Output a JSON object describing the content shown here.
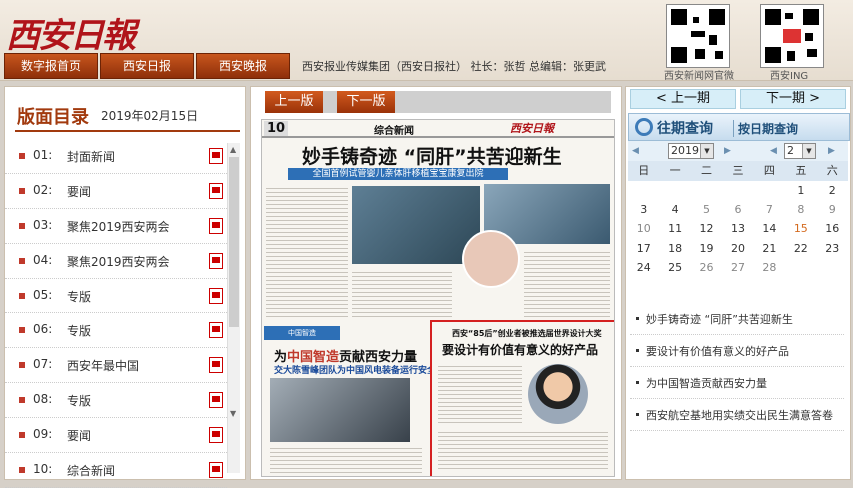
{
  "header": {
    "logo": "西安日報",
    "nav": [
      "数字报首页",
      "西安日报",
      "西安晚报"
    ],
    "info": "西安报业传媒集团（西安日报社）  社长：张哲    总编辑：张更武",
    "qr_labels": [
      "西安新闻网官微",
      "西安ING"
    ]
  },
  "left": {
    "title": "版面目录",
    "date": "2019年02月15日",
    "items": [
      {
        "num": "01:",
        "label": "封面新闻"
      },
      {
        "num": "02:",
        "label": "要闻"
      },
      {
        "num": "03:",
        "label": "聚焦2019西安两会"
      },
      {
        "num": "04:",
        "label": "聚焦2019西安两会"
      },
      {
        "num": "05:",
        "label": "专版"
      },
      {
        "num": "06:",
        "label": "专版"
      },
      {
        "num": "07:",
        "label": "西安年最中国"
      },
      {
        "num": "08:",
        "label": "专版"
      },
      {
        "num": "09:",
        "label": "要闻"
      },
      {
        "num": "10:",
        "label": "综合新闻"
      }
    ]
  },
  "center": {
    "prev_page": "上一版",
    "next_page": "下一版",
    "page": {
      "number": "10",
      "section": "综合新闻",
      "logo": "西安日報",
      "headline": "妙手铸奇迹 “同肝”共苦迎新生",
      "subheadline": "全国首例试管婴儿亲体肝移植宝宝康复出院",
      "mini_nav": "中国智造",
      "headline2_a": "为",
      "headline2_hl": "中国智造",
      "headline2_b": "贡献西安力量",
      "subheadline2": "交大陈雪峰团队为中国风电装备运行安全保驾护航",
      "box_sub": "西安“85后”创业者被推选届世界设计大奖",
      "box_title": "要设计有价值有意义的好产品"
    }
  },
  "right": {
    "prev_issue": "< 上一期",
    "next_issue": "下一期 >",
    "query_title": "往期查询",
    "query_sub": "按日期查询",
    "year": "2019",
    "month": "2",
    "weekdays": [
      "日",
      "一",
      "二",
      "三",
      "四",
      "五",
      "六"
    ],
    "weeks": [
      [
        "",
        "",
        "",
        "",
        "",
        "1",
        "2"
      ],
      [
        "3",
        "4",
        "5",
        "6",
        "7",
        "8",
        "9"
      ],
      [
        "10",
        "11",
        "12",
        "13",
        "14",
        "15",
        "16"
      ],
      [
        "17",
        "18",
        "19",
        "20",
        "21",
        "22",
        "23"
      ],
      [
        "24",
        "25",
        "26",
        "27",
        "28",
        "",
        ""
      ]
    ],
    "news": [
      "妙手铸奇迹 “同肝”共苦迎新生",
      "要设计有价值有意义的好产品",
      "为中国智造贡献西安力量",
      "西安航空基地用实绩交出民生满意答卷"
    ]
  }
}
